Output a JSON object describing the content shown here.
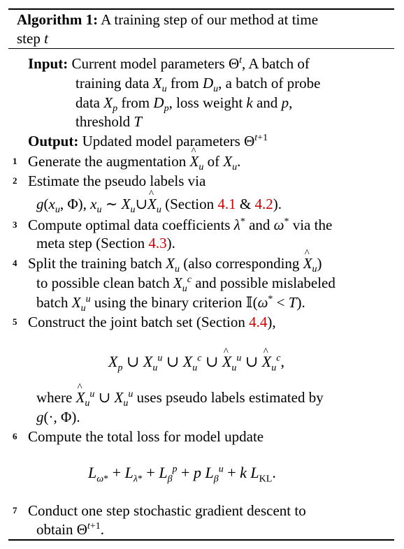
{
  "algorithm": {
    "label": "Algorithm 1:",
    "title_line1": "A training step of our method at time",
    "title_line2_text": "step"
  },
  "input": {
    "label": "Input:",
    "line1": "Current model parameters",
    "line1b": "A batch of",
    "line2a": "training data",
    "line2b": "from",
    "line2c": "a batch of probe",
    "line3a": "data",
    "line3b": "from",
    "line3c": "loss weight",
    "line3d": "and",
    "line4": "threshold"
  },
  "output": {
    "label": "Output:",
    "text": "Updated model parameters"
  },
  "steps": [
    {
      "num": "1",
      "text": "Generate the augmentation"
    },
    {
      "num": "2",
      "text": "Estimate the pseudo labels via",
      "cont": "(Section",
      "ref1": "4.1",
      "amp": "&",
      "ref2": "4.2",
      "end": ")."
    },
    {
      "num": "3",
      "text": "Compute optimal data coefficients",
      "mid": "and",
      "tail": "via the",
      "cont": "meta step (Section",
      "ref": "4.3",
      "end": ")."
    },
    {
      "num": "4",
      "text": "Split the training batch",
      "paren": "(also corresponding",
      "l2a": "to possible clean batch",
      "l2b": "and possible mislabeled",
      "l3a": "batch",
      "l3b": "using the binary criterion"
    },
    {
      "num": "5",
      "text": "Construct the joint batch set (Section",
      "ref": "4.4",
      "end": "),",
      "where1": "where",
      "where2": "uses pseudo labels estimated by"
    },
    {
      "num": "6",
      "text": "Compute the total loss for model update"
    },
    {
      "num": "7",
      "text": "Conduct one step stochastic gradient descent to",
      "cont": "obtain"
    }
  ]
}
